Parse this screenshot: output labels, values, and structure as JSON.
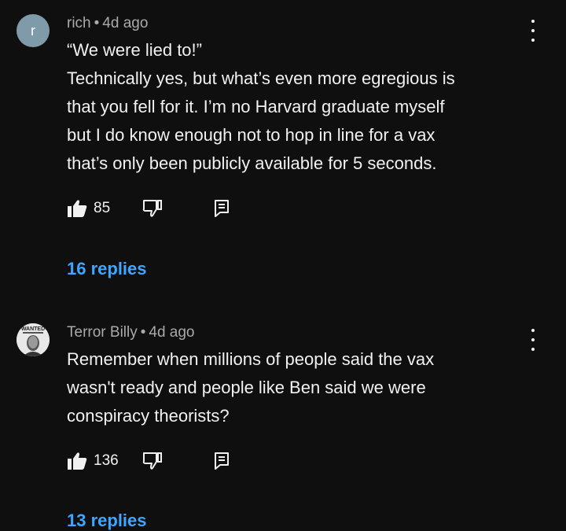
{
  "comments": [
    {
      "avatar_letter": "r",
      "author": "rich",
      "separator": "•",
      "time": "4d ago",
      "lines": [
        "“We were lied to!”",
        "Technically yes, but what’s even more egregious is",
        "that you fell for it. I’m no Harvard graduate myself",
        "but I do know enough not to hop in line for a vax",
        "that’s only been publicly available for 5 seconds."
      ],
      "likes": "85",
      "replies_label": "16 replies"
    },
    {
      "avatar_text": "WANTED",
      "author": "Terror Billy",
      "separator": "•",
      "time": "4d ago",
      "lines": [
        "Remember when millions of people said the vax",
        "wasn't ready and people like Ben said we were",
        "conspiracy theorists?"
      ],
      "likes": "136",
      "replies_label": "13 replies"
    }
  ],
  "colors": {
    "background": "#0f0f0f",
    "text": "#f1f1f1",
    "meta": "#aaaaaa",
    "link": "#3ea6ff",
    "avatar_bg": "#7f9aa9"
  },
  "icons": {
    "like": "thumb-up-icon",
    "dislike": "thumb-down-icon",
    "reply": "comment-reply-icon",
    "menu": "more-vert-icon"
  }
}
